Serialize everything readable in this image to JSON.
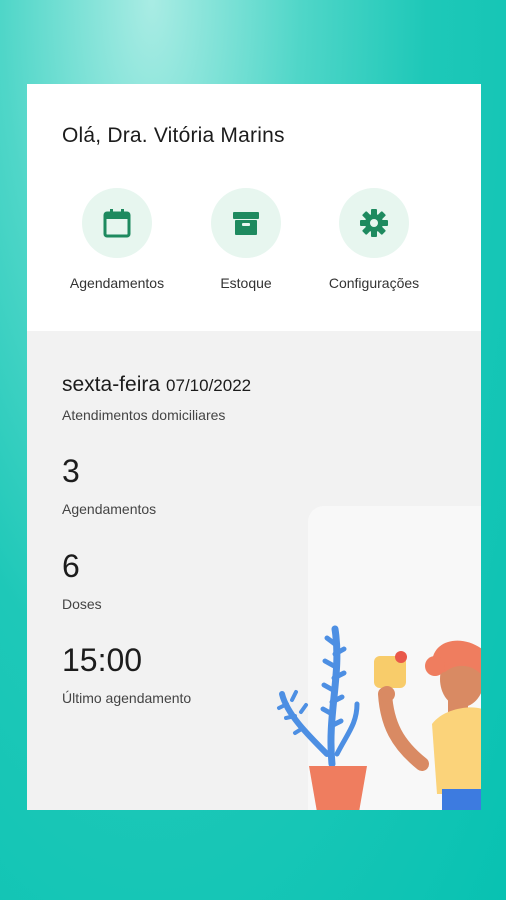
{
  "header": {
    "greeting": "Olá, Dra. Vitória Marins"
  },
  "actions": [
    {
      "label": "Agendamentos",
      "icon": "calendar-icon"
    },
    {
      "label": "Estoque",
      "icon": "archive-box-icon"
    },
    {
      "label": "Configurações",
      "icon": "gear-icon"
    }
  ],
  "summary": {
    "weekday": "sexta-feira",
    "date": "07/10/2022",
    "subtitle": "Atendimentos domiciliares",
    "stats": [
      {
        "value": "3",
        "label": "Agendamentos"
      },
      {
        "value": "6",
        "label": "Doses"
      },
      {
        "value": "15:00",
        "label": "Último agendamento"
      }
    ]
  },
  "colors": {
    "accent": "#1e8a5f",
    "icon_circle": "#e7f6ef",
    "background": "#1ec8b8"
  }
}
